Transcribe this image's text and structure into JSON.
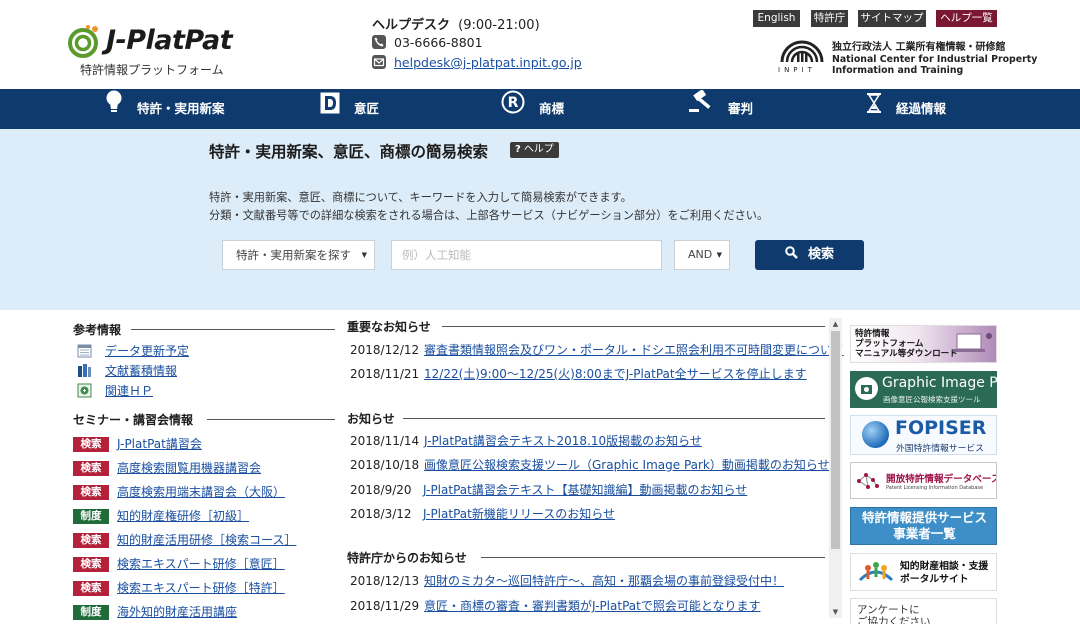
{
  "header": {
    "logo_text": "J-PlatPat",
    "logo_subtitle": "特許情報プラットフォーム",
    "help_desk": {
      "title": "ヘルプデスク",
      "hours": "(9:00-21:00)",
      "phone": "03-6666-8801",
      "email": "helpdesk@j-platpat.inpit.go.jp"
    },
    "util_links": [
      "English",
      "特許庁",
      "サイトマップ",
      "ヘルプ一覧"
    ],
    "inpit": {
      "jp_name": "独立行政法人 工業所有権情報・研修館",
      "en_line1": "National Center for Industrial Property",
      "en_line2": "Information and Training",
      "acronym": "INPIT"
    }
  },
  "nav": {
    "items": [
      {
        "label": "特許・実用新案",
        "icon": "lightbulb-icon"
      },
      {
        "label": "意匠",
        "icon": "design-d-icon"
      },
      {
        "label": "商標",
        "icon": "registered-r-icon"
      },
      {
        "label": "審判",
        "icon": "gavel-icon"
      },
      {
        "label": "経過情報",
        "icon": "hourglass-icon"
      }
    ]
  },
  "search": {
    "title": "特許・実用新案、意匠、商標の簡易検索",
    "help_label": "ヘルプ",
    "help_mark": "?",
    "desc1": "特許・実用新案、意匠、商標について、キーワードを入力して簡易検索ができます。",
    "desc2": "分類・文献番号等での詳細な検索をされる場合は、上部各サービス（ナビゲーション部分）をご利用ください。",
    "type_select": "特許・実用新案を探す",
    "input_placeholder": "例）人工知能",
    "andor_select": "AND",
    "button_label": "検索"
  },
  "left": {
    "reference_title": "参考情報",
    "reference_items": [
      {
        "label": "データ更新予定",
        "icon": "calendar-icon"
      },
      {
        "label": "文献蓄積情報",
        "icon": "books-icon"
      },
      {
        "label": "関連ＨＰ",
        "icon": "link-icon"
      }
    ],
    "seminar_title": "セミナー・講習会情報",
    "seminar_items": [
      {
        "tag": "検索",
        "kind": "k",
        "label": "J-PlatPat講習会"
      },
      {
        "tag": "検索",
        "kind": "k",
        "label": "高度検索閲覧用機器講習会"
      },
      {
        "tag": "検索",
        "kind": "k",
        "label": "高度検索用端末講習会（大阪）"
      },
      {
        "tag": "制度",
        "kind": "s",
        "label": "知的財産権研修［初級］"
      },
      {
        "tag": "検索",
        "kind": "k",
        "label": "知的財産活用研修［検索コース］"
      },
      {
        "tag": "検索",
        "kind": "k",
        "label": "検索エキスパート研修［意匠］"
      },
      {
        "tag": "検索",
        "kind": "k",
        "label": "検索エキスパート研修［特許］"
      },
      {
        "tag": "制度",
        "kind": "s",
        "label": "海外知的財産活用講座"
      }
    ]
  },
  "news": {
    "important_title": "重要なお知らせ",
    "important": [
      {
        "date": "2018/12/12",
        "text": "審査書類情報照会及びワン・ポータル・ドシエ照会利用不可時間変更について"
      },
      {
        "date": "2018/11/21",
        "text": "12/22(土)9:00～12/25(火)8:00までJ-PlatPat全サービスを停止します"
      }
    ],
    "notice_title": "お知らせ",
    "notices": [
      {
        "date": "2018/11/14",
        "text": "J-PlatPat講習会テキスト2018.10版掲載のお知らせ"
      },
      {
        "date": "2018/10/18",
        "text": "画像意匠公報検索支援ツール（Graphic Image Park）動画掲載のお知らせ"
      },
      {
        "date": "2018/9/20",
        "text": "J-PlatPat講習会テキスト【基礎知識編】動画掲載のお知らせ"
      },
      {
        "date": "2018/3/12",
        "text": "J-PlatPat新機能リリースのお知らせ"
      }
    ],
    "jpo_title": "特許庁からのお知らせ",
    "jpo": [
      {
        "date": "2018/12/13",
        "text": "知財のミカタ～巡回特許庁～、高知・那覇会場の事前登録受付中！"
      },
      {
        "date": "2018/11/29",
        "text": "意匠・商標の審査・審判書類がJ-PlatPatで照会可能となります"
      }
    ]
  },
  "banners": {
    "manual": [
      "特許情報",
      "プラットフォーム",
      "マニュアル等ダウンロード"
    ],
    "gip_title": "Graphic Image Park",
    "gip_sub": "画像意匠公報検索支援ツール",
    "fopiser_title": "FOPISER",
    "fopiser_sub": "外国特許情報サービス",
    "license_title": "開放特許情報データベース",
    "license_sub": "Patent Licensing Information Database",
    "provider": [
      "特許情報提供サービス",
      "事業者一覧"
    ],
    "portal": [
      "知的財産相談・支援",
      "ポータルサイト"
    ],
    "survey": [
      "アンケートに",
      "ご協力ください"
    ]
  },
  "colors": {
    "nav_bg": "#0e3a6e",
    "search_bg": "#dcecf8",
    "tag_search": "#b5213a",
    "tag_system": "#1f6b3a",
    "help_list_bg": "#7a1732"
  }
}
